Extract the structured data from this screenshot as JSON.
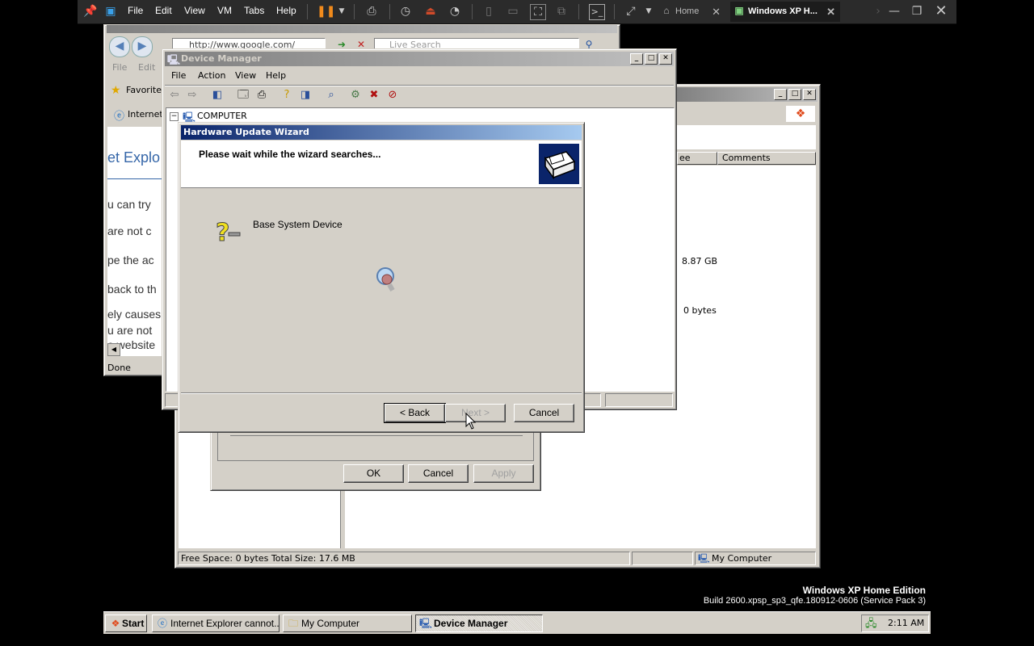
{
  "vmware": {
    "menu": [
      "File",
      "Edit",
      "View",
      "VM",
      "Tabs",
      "Help"
    ],
    "tabs": [
      {
        "label": "Home",
        "icon": "home-icon"
      },
      {
        "label": "Windows XP H...",
        "icon": "vm-icon"
      }
    ]
  },
  "ie": {
    "address": "http://www.google.com/",
    "search_placeholder": "Live Search",
    "menu": [
      "File",
      "Edit"
    ],
    "favorites_label": "Favorites",
    "tab_label": "Internet",
    "body_heading": "et Explo",
    "body_lines": [
      "u can try",
      "are not c",
      "pe the ac",
      "back to th",
      "ely causes",
      "u are not",
      "e website"
    ],
    "status": "Done"
  },
  "device_manager": {
    "title": "Device Manager",
    "menu": [
      "File",
      "Action",
      "View",
      "Help"
    ],
    "tree_root": "COMPUTER"
  },
  "my_computer": {
    "columns": [
      "ee Space",
      "Comments"
    ],
    "values": [
      "8.87 GB",
      "0 bytes"
    ],
    "status_left": "Free Space: 0 bytes Total Size: 17.6 MB",
    "status_right": "My Computer"
  },
  "properties": {
    "ok": "OK",
    "cancel": "Cancel",
    "apply": "Apply"
  },
  "wizard": {
    "title": "Hardware Update Wizard",
    "heading": "Please wait while the wizard searches...",
    "device_name": "Base System Device",
    "back": "< Back",
    "next": "Next >",
    "cancel": "Cancel"
  },
  "desktop": {
    "edition": "Windows XP Home Edition",
    "build": "Build 2600.xpsp_sp3_qfe.180912-0606 (Service Pack 3)"
  },
  "taskbar": {
    "start": "Start",
    "buttons": [
      {
        "label": "Internet Explorer cannot..."
      },
      {
        "label": "My Computer"
      },
      {
        "label": "Device Manager"
      }
    ],
    "clock": "2:11 AM"
  }
}
